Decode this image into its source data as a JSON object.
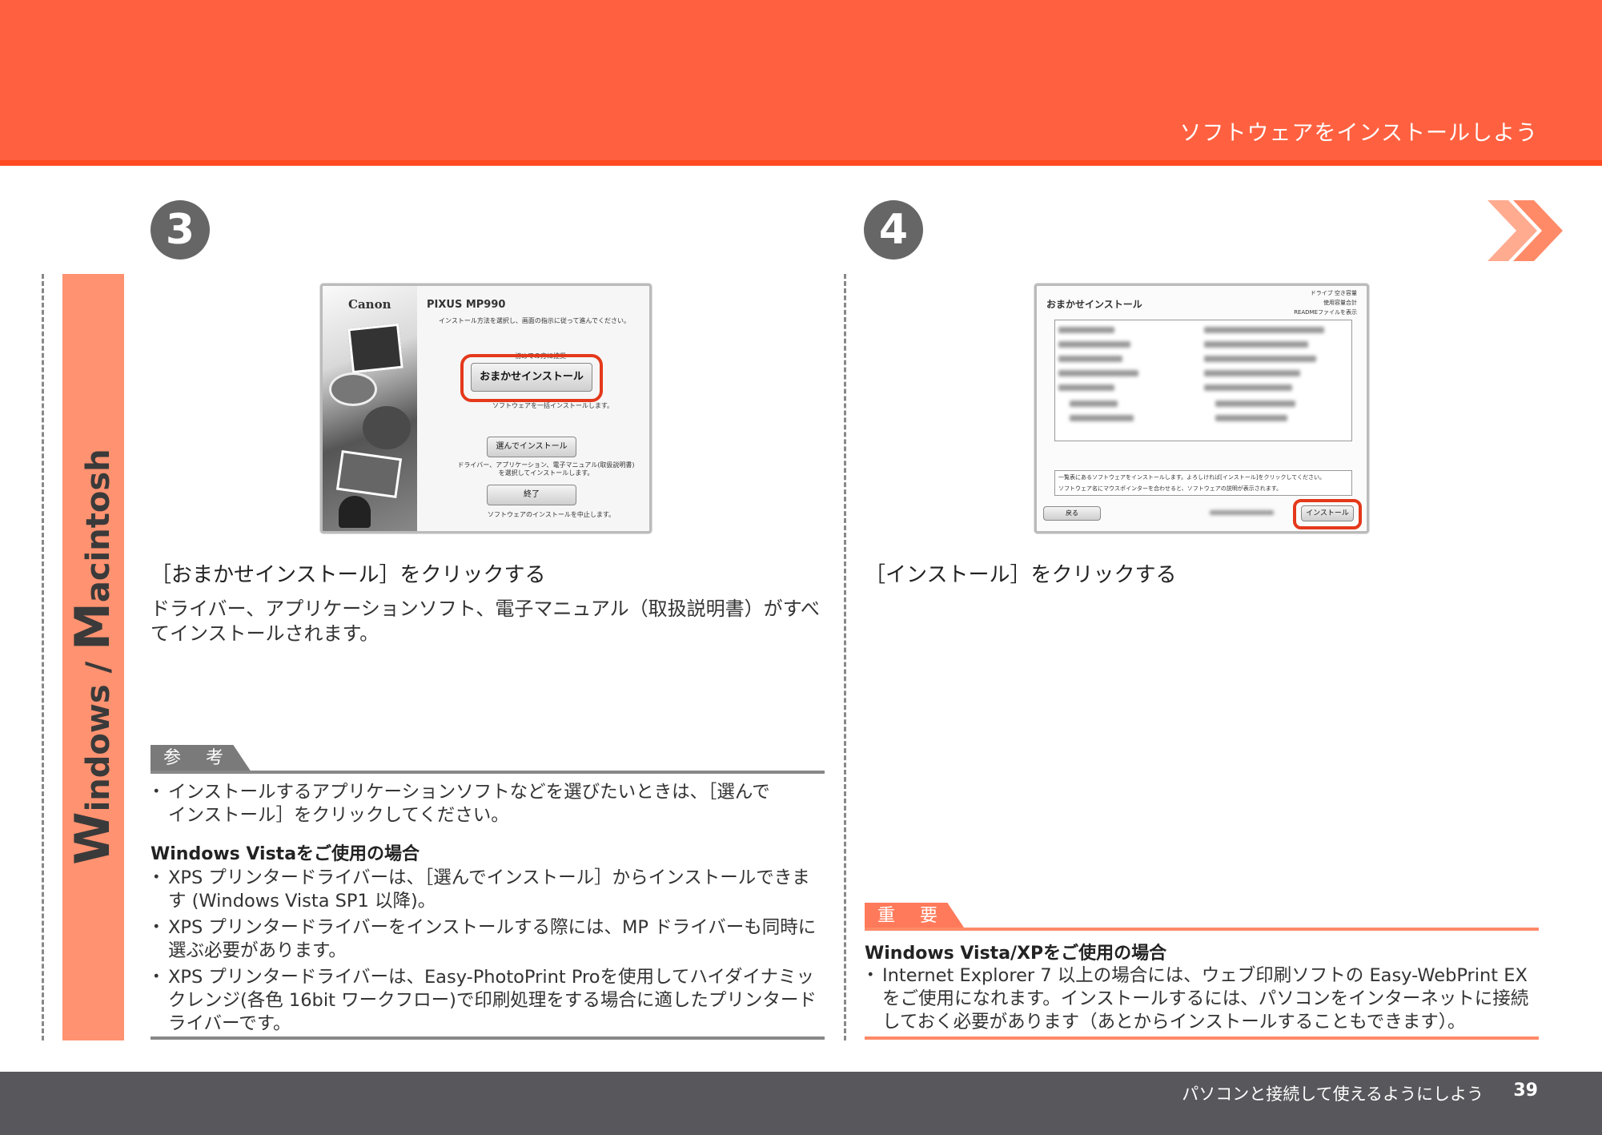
{
  "header": {
    "title": "ソフトウェアをインストールしよう"
  },
  "side_tab": {
    "label_w": "W",
    "label_mid": "indows / ",
    "label_m": "M",
    "label_end": "acintosh"
  },
  "step3": {
    "number": "3",
    "screenshot": {
      "brand": "Canon",
      "product": "PIXUS MP990",
      "instruction": "インストール方法を選択し、画面の指示に従って進んでください。",
      "option_caption": "初めての方に推奨",
      "easy_install_button": "おまかせインストール",
      "easy_install_desc": "ソフトウェアを一括インストールします。",
      "custom_install_button": "選んでインストール",
      "custom_install_desc": "ドライバー、アプリケーション、電子マニュアル(取扱説明書)を選択してインストールします。",
      "exit_button": "終了",
      "exit_desc": "ソフトウェアのインストールを中止します。"
    },
    "heading": "［おまかせインストール］をクリックする",
    "body": "ドライバー、アプリケーションソフト、電子マニュアル（取扱説明書）がすべてインストールされます。",
    "note_label": "参 考",
    "note_bullet": "インストールするアプリケーションソフトなどを選びたいときは、［選んでインストール］をクリックしてください。",
    "vista_heading": "Windows Vistaをご使用の場合",
    "vista_bullets": [
      "XPS プリンタードライバーは、［選んでインストール］からインストールできます (Windows Vista SP1 以降)。",
      "XPS プリンタードライバーをインストールする際には、MP ドライバーも同時に選ぶ必要があります。",
      "XPS プリンタードライバーは、Easy-PhotoPrint Proを使用してハイダイナミックレンジ(各色 16bit ワークフロー)で印刷処理をする場合に適したプリンタードライバーです。"
    ]
  },
  "step4": {
    "number": "4",
    "screenshot": {
      "title": "おまかせインストール",
      "drive_info_1": "ドライブ 空き容量",
      "drive_info_2": "使用容量合計",
      "drive_info_3": "READMEファイルを表示",
      "message_1": "一覧表にあるソフトウェアをインストールします。よろしければ[インストール]をクリックしてください。",
      "message_2": "ソフトウェア名にマウスポインターを合わせると、ソフトウェアの説明が表示されます。",
      "back_button": "戻る",
      "install_button": "インストール"
    },
    "heading": "［インストール］をクリックする",
    "important_label": "重 要",
    "important_heading": "Windows Vista/XPをご使用の場合",
    "important_bullet": "Internet Explorer 7 以上の場合には、ウェブ印刷ソフトの Easy-WebPrint EX をご使用になれます。インストールするには、パソコンをインターネットに接続しておく必要があります（あとからインストールすることもできます）。"
  },
  "footer": {
    "text": "パソコンと接続して使えるようにしよう",
    "page": "39"
  },
  "colors": {
    "accent": "#ff6140",
    "accent_light": "#ff9270",
    "gray": "#666666",
    "footer": "#58575c"
  }
}
